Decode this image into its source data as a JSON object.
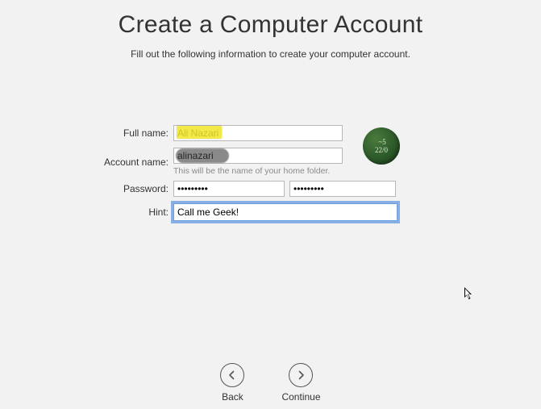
{
  "header": {
    "title": "Create a Computer Account",
    "subtitle": "Fill out the following information to create your computer account."
  },
  "form": {
    "fullname_label": "Full name:",
    "fullname_value": "Ali Nazari",
    "accountname_label": "Account name:",
    "accountname_value": "alinazari",
    "accountname_helper": "This will be the name of your home folder.",
    "password_label": "Password:",
    "password_value": "•••••••••",
    "password_verify_value": "•••••••••",
    "hint_label": "Hint:",
    "hint_value": "Call me Geek!"
  },
  "avatar": {
    "content": " ~5\n22/0"
  },
  "nav": {
    "back_label": "Back",
    "continue_label": "Continue"
  }
}
